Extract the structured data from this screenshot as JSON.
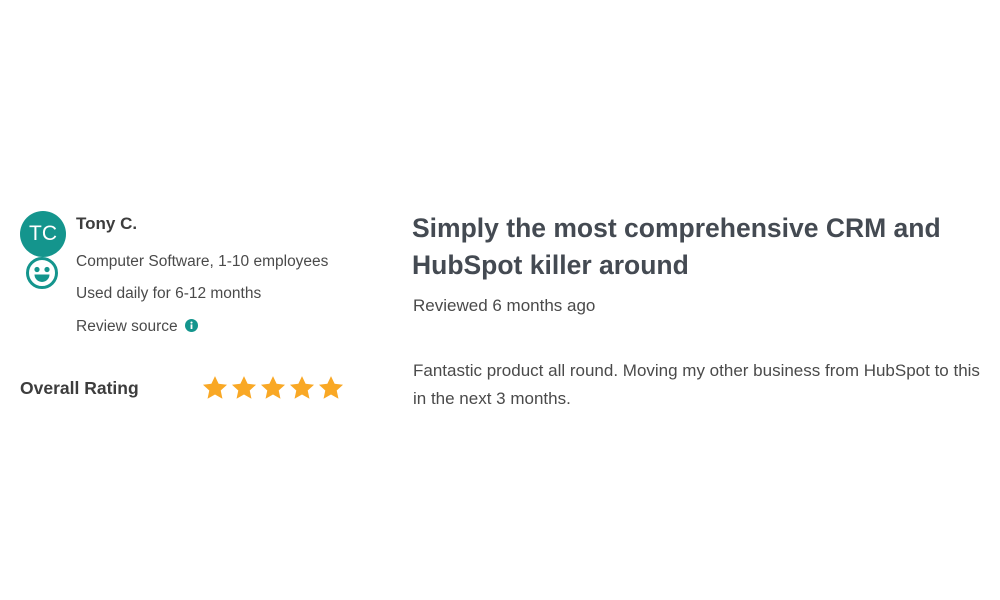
{
  "reviewer": {
    "initials": "TC",
    "name": "Tony C.",
    "industry": "Computer Software, 1-10 employees",
    "usage": "Used daily for 6-12 months",
    "source_label": "Review source",
    "avatar_color": "#14958d",
    "sentiment_icon": "happy-face-icon"
  },
  "rating": {
    "label": "Overall Rating",
    "stars": 5,
    "max_stars": 5,
    "star_color": "#f9a825"
  },
  "review": {
    "title": "Simply the most comprehensive CRM and HubSpot killer around",
    "date": "Reviewed 6 months ago",
    "body": "Fantastic product all round. Moving my other business from HubSpot to this in the next 3 months."
  }
}
